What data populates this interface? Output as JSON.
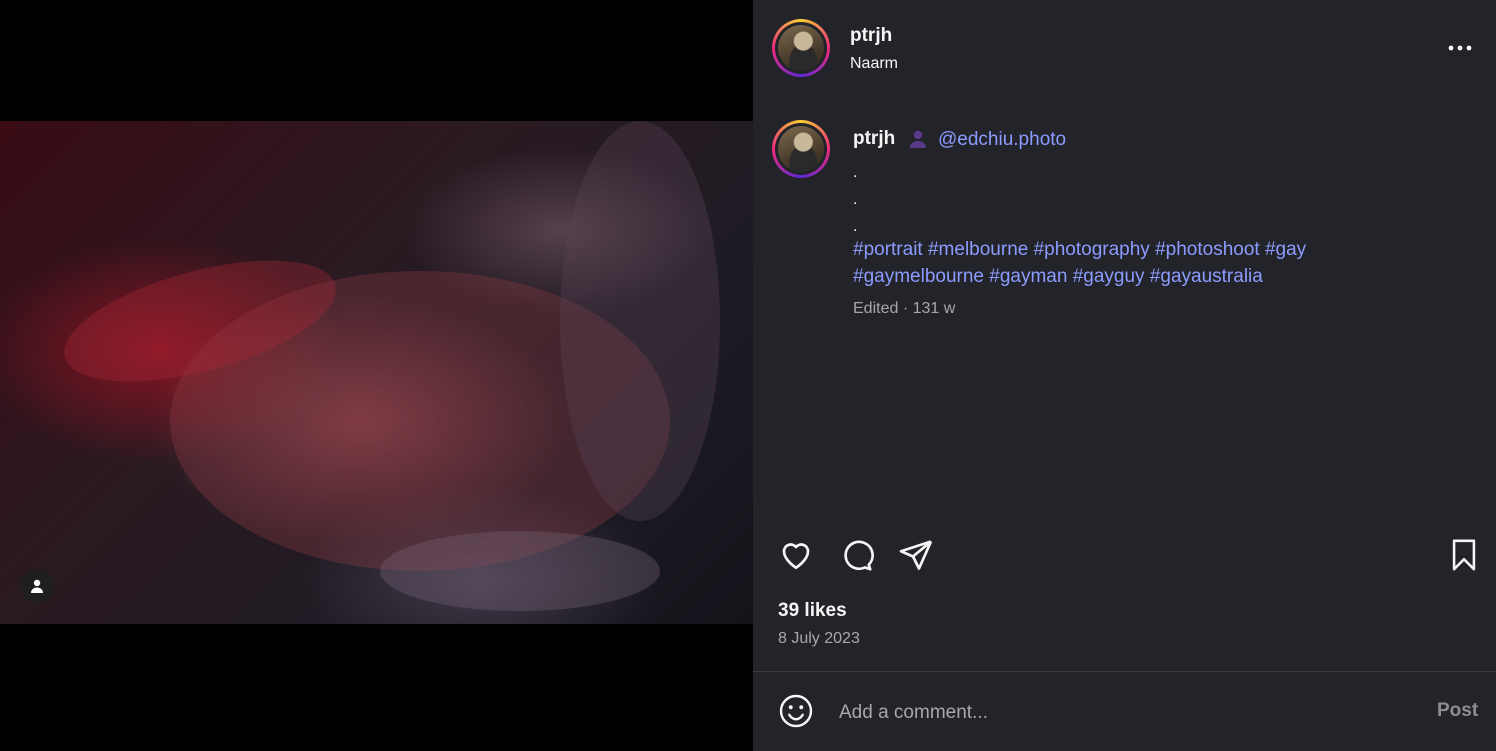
{
  "post": {
    "username": "ptrjh",
    "location": "Naarm",
    "caption": {
      "username": "ptrjh",
      "mention": "@edchiu.photo",
      "dots": [
        ".",
        ".",
        "."
      ],
      "hashtags_line1": "#portrait #melbourne #photography #photoshoot #gay",
      "hashtags_line2": "#gaymelbourne #gayman #gayguy #gayaustralia",
      "edited": "Edited · 131 w"
    },
    "likes": "39 likes",
    "date": "8 July 2023"
  },
  "comment": {
    "placeholder": "Add a comment...",
    "post_label": "Post"
  },
  "colors": {
    "panel_bg": "#232429",
    "link": "#8c9bff",
    "muted": "#a8a8a8"
  },
  "icons": [
    "more-icon",
    "user-tag-icon",
    "heart-icon",
    "comment-icon",
    "share-icon",
    "bookmark-icon",
    "emoji-icon",
    "person-icon"
  ]
}
